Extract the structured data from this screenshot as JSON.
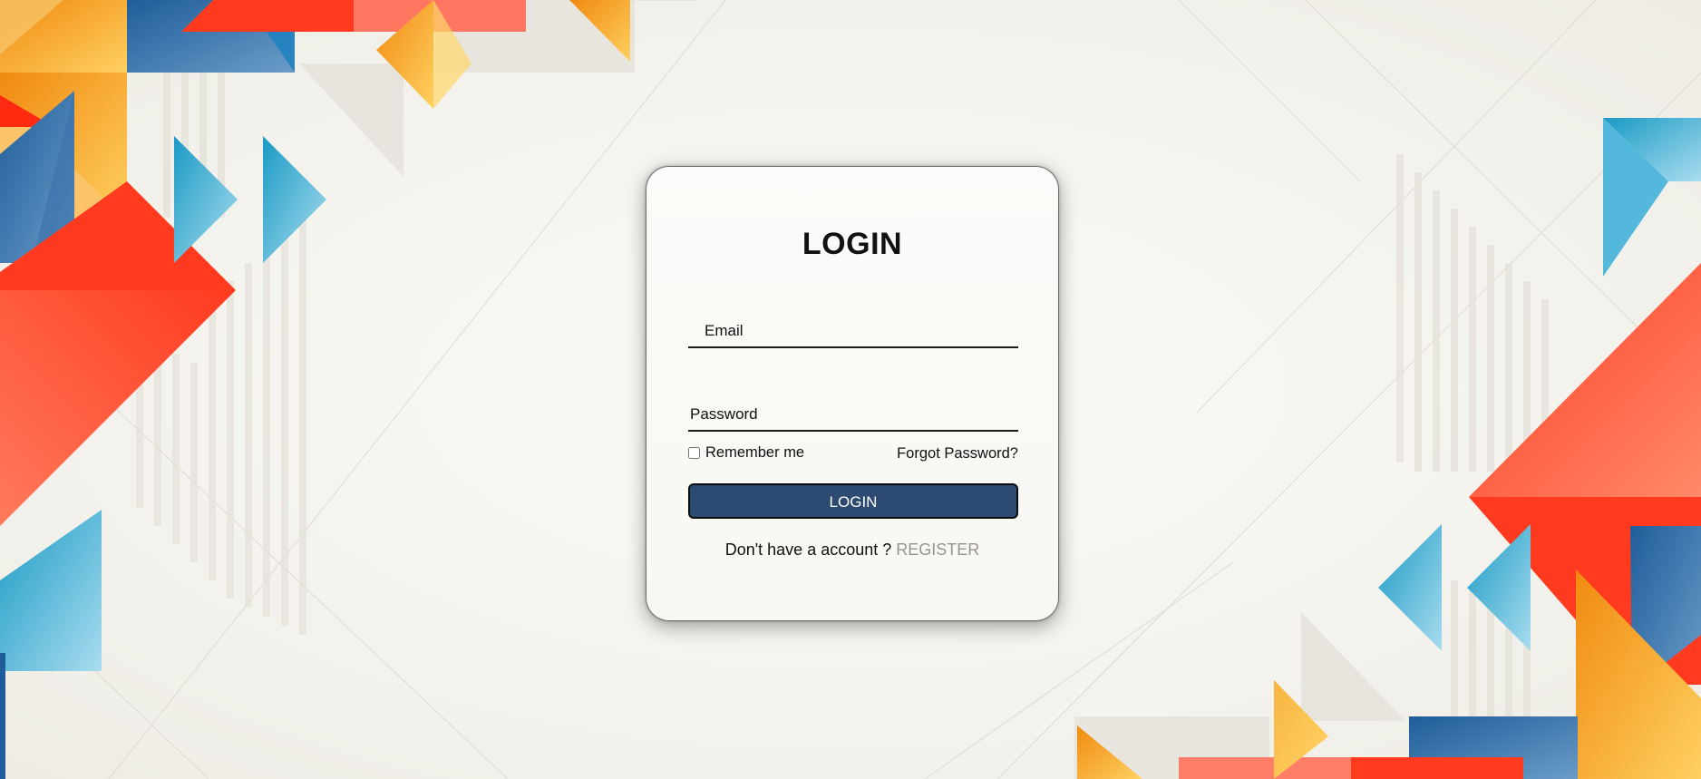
{
  "login_card": {
    "title": "LOGIN",
    "email_placeholder": "Email",
    "password_placeholder": "Password",
    "remember_label": "Remember me",
    "remember_checked": false,
    "forgot_label": "Forgot Password?",
    "login_button_label": "LOGIN",
    "register_prompt": "Don't have a account ?",
    "register_label": "REGISTER"
  },
  "colors": {
    "button_bg": "#2c4a72",
    "register_link": "#9a9490",
    "accent_red": "#ff4a2a",
    "accent_orange": "#f7a21b",
    "accent_blue": "#2ea3cc",
    "accent_navy": "#2a5e95"
  }
}
